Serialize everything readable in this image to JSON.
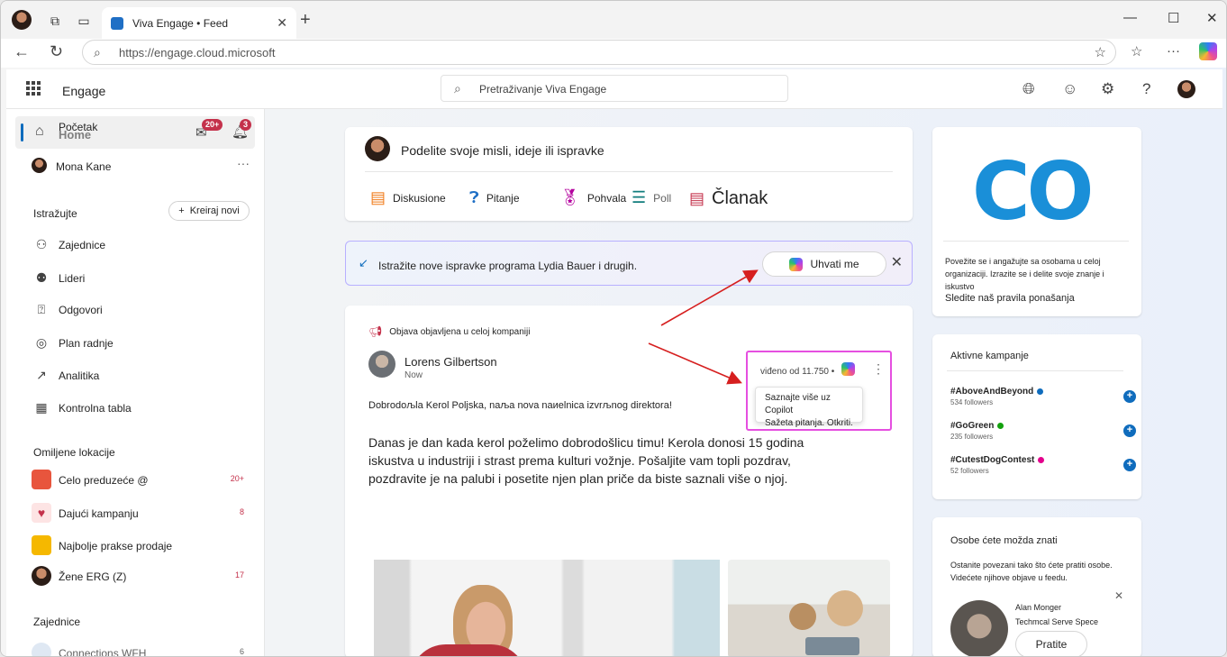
{
  "browser": {
    "tab_title": "Viva Engage • Feed",
    "url": "https://engage.cloud.microsoft"
  },
  "header": {
    "app_name": "Engage",
    "search_placeholder": "Pretraživanje Viva Engage"
  },
  "sidebar": {
    "home_label": "Početak",
    "home_label_overlap": "Home",
    "inbox_badge": "20+",
    "notif_badge": "3",
    "user_name": "Mona Kane",
    "user_more": "···",
    "explore_title": "Istražujte",
    "create_label": "Kreiraj novi",
    "nav_items": [
      {
        "label": "Zajednice",
        "icon": "communities-icon"
      },
      {
        "label": "Lideri",
        "icon": "leaders-icon"
      },
      {
        "label": "Odgovori",
        "icon": "answers-icon"
      },
      {
        "label": "Plan radnje",
        "icon": "storyline-icon"
      },
      {
        "label": "Analitika",
        "icon": "analytics-icon"
      },
      {
        "label": "Kontrolna tabla",
        "icon": "dashboard-icon"
      }
    ],
    "favorites_title": "Omiljene lokacije",
    "favorites": [
      {
        "label": "Celo preduzeće @",
        "count": "20+",
        "color": "#e8553d"
      },
      {
        "label": "Dajući kampanju",
        "count": "8",
        "color": "#fde4e4"
      },
      {
        "label": "Najbolje prakse prodaje",
        "count": "",
        "color": "#f5b800"
      },
      {
        "label": "Žene ERG (Z)",
        "count": "17",
        "color": "#8a5a44"
      }
    ],
    "communities_title": "Zajednice",
    "communities_first": "Connections WFH",
    "communities_first_count": "6"
  },
  "composer": {
    "prompt": "Podelite svoje misli, ideje ili ispravke",
    "types": [
      {
        "label": "Diskusione",
        "icon": "discussion-icon",
        "color": "#f07c1c"
      },
      {
        "label": "Pitanje",
        "icon": "question-icon",
        "color": "#1f6fc5"
      },
      {
        "label": "Pohvala",
        "icon": "praise-icon",
        "color": "#b4009e"
      },
      {
        "label": "Poll",
        "icon": "poll-icon",
        "color": "#107c7c"
      },
      {
        "label": "Članak",
        "icon": "article-icon",
        "color": "#c4314b"
      }
    ]
  },
  "discover": {
    "text": "Istražite nove ispravke programa Lydia Bauer i drugih.",
    "button": "Uhvati me"
  },
  "post": {
    "announcement": "Objava objavljena u celoj kompaniji",
    "author": "Lorens Gilbertson",
    "time": "Now",
    "headline": "Dobrodoљla Kerol Poljska, naљa nova naиelnica izvrљnog direktora!",
    "body": "Danas je dan kada kerol poželimo dobrodošlicu timu! Kerola donosi 15 godina iskustva u industriji i strast prema kulturi vožnje. Pošaljite vam topli pozdrav, pozdravite je na palubi i posetite njen plan priče da biste saznali više o njoj.",
    "seen": "viđeno od 11.750",
    "seen_sep": "•",
    "tooltip_line1": "Saznajte više uz Copilot",
    "tooltip_line2": "Sažeta pitanja. Otkriti."
  },
  "right": {
    "co_logo": "CO",
    "co_desc": "Povežite se i angažujte sa osobama u celoj organizaciji. Izrazite se i delite svoje znanje i iskustvo",
    "co_link": "Sledite naš pravila ponašanja",
    "campaigns_title": "Aktivne kampanje",
    "campaigns": [
      {
        "tag": "#AboveAndBeyond",
        "followers": "534 followers",
        "color": "#0f6cbd"
      },
      {
        "tag": "#GoGreen",
        "followers": "235 followers",
        "color": "#13a10e"
      },
      {
        "tag": "#CutestDogContest",
        "followers": "52 followers",
        "color": "#e3008c"
      }
    ],
    "people_title": "Osobe ćete možda znati",
    "people_desc": "Ostanite povezani tako što ćete pratiti osobe. Videćete njihove objave u feedu.",
    "person_name": "Alan Monger",
    "person_role": "Techmcal Serve Spece",
    "follow": "Pratite"
  },
  "colors": {
    "accent": "#0f6cbd",
    "badge": "#c4314b",
    "highlight_box": "#e54fe0",
    "arrow": "#d61f1f"
  }
}
